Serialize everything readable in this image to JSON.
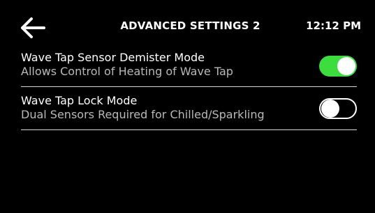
{
  "header": {
    "title": "ADVANCED SETTINGS 2",
    "time": "12:12 PM",
    "back_icon": "arrow-left-icon"
  },
  "settings": [
    {
      "title": "Wave Tap Sensor Demister Mode",
      "description": "Allows Control of Heating of Wave Tap",
      "enabled": true
    },
    {
      "title": "Wave Tap Lock Mode",
      "description": "Dual Sensors Required for Chilled/Sparkling",
      "enabled": false
    }
  ],
  "colors": {
    "background": "#000000",
    "toggle_on": "#3ddc3f",
    "text_primary": "#ffffff",
    "text_secondary": "#b9b9b9",
    "divider": "#d8d8d8"
  }
}
